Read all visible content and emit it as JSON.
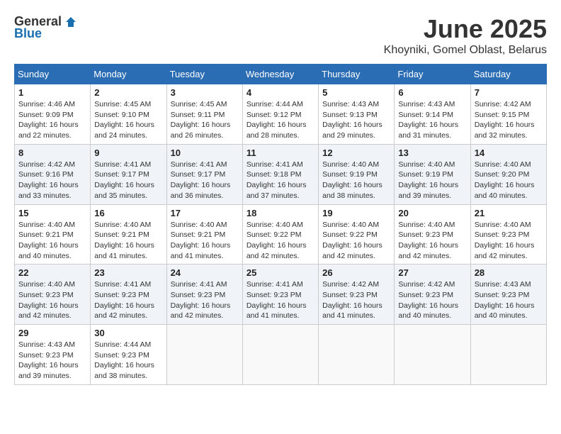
{
  "logo": {
    "general": "General",
    "blue": "Blue"
  },
  "title": "June 2025",
  "location": "Khoyniki, Gomel Oblast, Belarus",
  "weekdays": [
    "Sunday",
    "Monday",
    "Tuesday",
    "Wednesday",
    "Thursday",
    "Friday",
    "Saturday"
  ],
  "weeks": [
    [
      {
        "day": "1",
        "sunrise": "Sunrise: 4:46 AM",
        "sunset": "Sunset: 9:09 PM",
        "daylight": "Daylight: 16 hours and 22 minutes."
      },
      {
        "day": "2",
        "sunrise": "Sunrise: 4:45 AM",
        "sunset": "Sunset: 9:10 PM",
        "daylight": "Daylight: 16 hours and 24 minutes."
      },
      {
        "day": "3",
        "sunrise": "Sunrise: 4:45 AM",
        "sunset": "Sunset: 9:11 PM",
        "daylight": "Daylight: 16 hours and 26 minutes."
      },
      {
        "day": "4",
        "sunrise": "Sunrise: 4:44 AM",
        "sunset": "Sunset: 9:12 PM",
        "daylight": "Daylight: 16 hours and 28 minutes."
      },
      {
        "day": "5",
        "sunrise": "Sunrise: 4:43 AM",
        "sunset": "Sunset: 9:13 PM",
        "daylight": "Daylight: 16 hours and 29 minutes."
      },
      {
        "day": "6",
        "sunrise": "Sunrise: 4:43 AM",
        "sunset": "Sunset: 9:14 PM",
        "daylight": "Daylight: 16 hours and 31 minutes."
      },
      {
        "day": "7",
        "sunrise": "Sunrise: 4:42 AM",
        "sunset": "Sunset: 9:15 PM",
        "daylight": "Daylight: 16 hours and 32 minutes."
      }
    ],
    [
      {
        "day": "8",
        "sunrise": "Sunrise: 4:42 AM",
        "sunset": "Sunset: 9:16 PM",
        "daylight": "Daylight: 16 hours and 33 minutes."
      },
      {
        "day": "9",
        "sunrise": "Sunrise: 4:41 AM",
        "sunset": "Sunset: 9:17 PM",
        "daylight": "Daylight: 16 hours and 35 minutes."
      },
      {
        "day": "10",
        "sunrise": "Sunrise: 4:41 AM",
        "sunset": "Sunset: 9:17 PM",
        "daylight": "Daylight: 16 hours and 36 minutes."
      },
      {
        "day": "11",
        "sunrise": "Sunrise: 4:41 AM",
        "sunset": "Sunset: 9:18 PM",
        "daylight": "Daylight: 16 hours and 37 minutes."
      },
      {
        "day": "12",
        "sunrise": "Sunrise: 4:40 AM",
        "sunset": "Sunset: 9:19 PM",
        "daylight": "Daylight: 16 hours and 38 minutes."
      },
      {
        "day": "13",
        "sunrise": "Sunrise: 4:40 AM",
        "sunset": "Sunset: 9:19 PM",
        "daylight": "Daylight: 16 hours and 39 minutes."
      },
      {
        "day": "14",
        "sunrise": "Sunrise: 4:40 AM",
        "sunset": "Sunset: 9:20 PM",
        "daylight": "Daylight: 16 hours and 40 minutes."
      }
    ],
    [
      {
        "day": "15",
        "sunrise": "Sunrise: 4:40 AM",
        "sunset": "Sunset: 9:21 PM",
        "daylight": "Daylight: 16 hours and 40 minutes."
      },
      {
        "day": "16",
        "sunrise": "Sunrise: 4:40 AM",
        "sunset": "Sunset: 9:21 PM",
        "daylight": "Daylight: 16 hours and 41 minutes."
      },
      {
        "day": "17",
        "sunrise": "Sunrise: 4:40 AM",
        "sunset": "Sunset: 9:21 PM",
        "daylight": "Daylight: 16 hours and 41 minutes."
      },
      {
        "day": "18",
        "sunrise": "Sunrise: 4:40 AM",
        "sunset": "Sunset: 9:22 PM",
        "daylight": "Daylight: 16 hours and 42 minutes."
      },
      {
        "day": "19",
        "sunrise": "Sunrise: 4:40 AM",
        "sunset": "Sunset: 9:22 PM",
        "daylight": "Daylight: 16 hours and 42 minutes."
      },
      {
        "day": "20",
        "sunrise": "Sunrise: 4:40 AM",
        "sunset": "Sunset: 9:23 PM",
        "daylight": "Daylight: 16 hours and 42 minutes."
      },
      {
        "day": "21",
        "sunrise": "Sunrise: 4:40 AM",
        "sunset": "Sunset: 9:23 PM",
        "daylight": "Daylight: 16 hours and 42 minutes."
      }
    ],
    [
      {
        "day": "22",
        "sunrise": "Sunrise: 4:40 AM",
        "sunset": "Sunset: 9:23 PM",
        "daylight": "Daylight: 16 hours and 42 minutes."
      },
      {
        "day": "23",
        "sunrise": "Sunrise: 4:41 AM",
        "sunset": "Sunset: 9:23 PM",
        "daylight": "Daylight: 16 hours and 42 minutes."
      },
      {
        "day": "24",
        "sunrise": "Sunrise: 4:41 AM",
        "sunset": "Sunset: 9:23 PM",
        "daylight": "Daylight: 16 hours and 42 minutes."
      },
      {
        "day": "25",
        "sunrise": "Sunrise: 4:41 AM",
        "sunset": "Sunset: 9:23 PM",
        "daylight": "Daylight: 16 hours and 41 minutes."
      },
      {
        "day": "26",
        "sunrise": "Sunrise: 4:42 AM",
        "sunset": "Sunset: 9:23 PM",
        "daylight": "Daylight: 16 hours and 41 minutes."
      },
      {
        "day": "27",
        "sunrise": "Sunrise: 4:42 AM",
        "sunset": "Sunset: 9:23 PM",
        "daylight": "Daylight: 16 hours and 40 minutes."
      },
      {
        "day": "28",
        "sunrise": "Sunrise: 4:43 AM",
        "sunset": "Sunset: 9:23 PM",
        "daylight": "Daylight: 16 hours and 40 minutes."
      }
    ],
    [
      {
        "day": "29",
        "sunrise": "Sunrise: 4:43 AM",
        "sunset": "Sunset: 9:23 PM",
        "daylight": "Daylight: 16 hours and 39 minutes."
      },
      {
        "day": "30",
        "sunrise": "Sunrise: 4:44 AM",
        "sunset": "Sunset: 9:23 PM",
        "daylight": "Daylight: 16 hours and 38 minutes."
      },
      null,
      null,
      null,
      null,
      null
    ]
  ]
}
